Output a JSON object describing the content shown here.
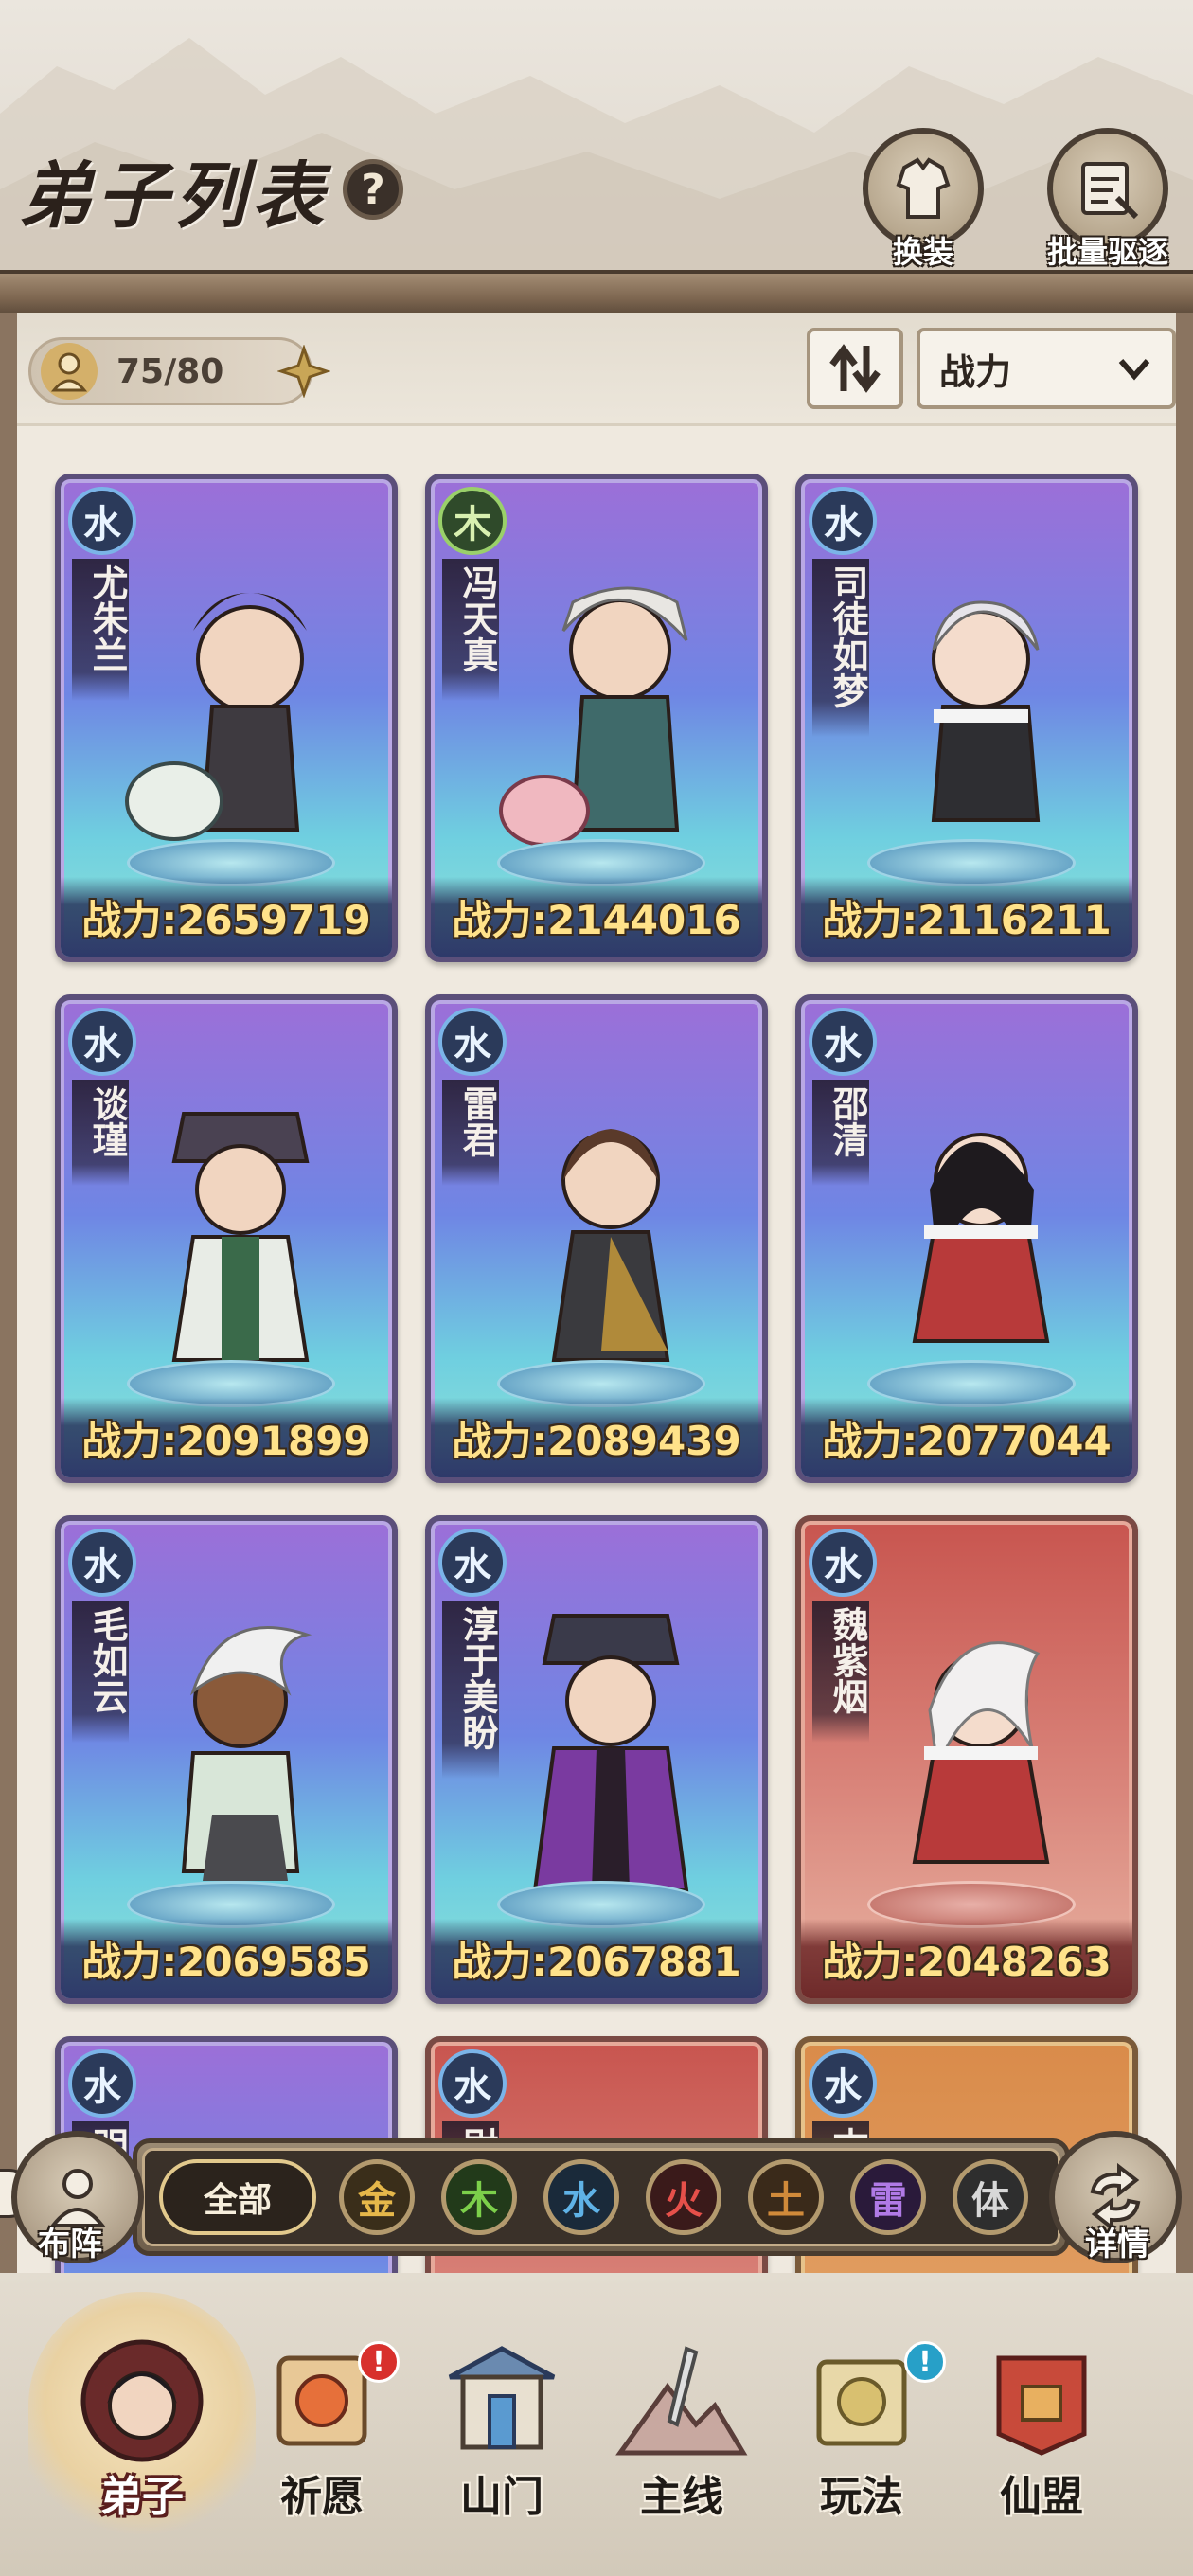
{
  "header": {
    "title": "弟子列表",
    "help_label": "?",
    "buttons": [
      {
        "label": "换装",
        "icon": "outfit-icon"
      },
      {
        "label": "批量驱逐",
        "icon": "dismiss-scroll-icon"
      }
    ]
  },
  "toolbar": {
    "capacity_text": "75/80",
    "sort_value": "战力"
  },
  "cards": [
    {
      "element": "水",
      "name": "尤朱兰",
      "power": "战力:2659719",
      "rarity": "purple"
    },
    {
      "element": "木",
      "name": "冯天真",
      "power": "战力:2144016",
      "rarity": "purple"
    },
    {
      "element": "水",
      "name": "司徒如梦",
      "power": "战力:2116211",
      "rarity": "purple"
    },
    {
      "element": "水",
      "name": "谈瑾",
      "power": "战力:2091899",
      "rarity": "purple"
    },
    {
      "element": "水",
      "name": "雷君",
      "power": "战力:2089439",
      "rarity": "purple"
    },
    {
      "element": "水",
      "name": "邵清",
      "power": "战力:2077044",
      "rarity": "purple"
    },
    {
      "element": "水",
      "name": "毛如云",
      "power": "战力:2069585",
      "rarity": "purple"
    },
    {
      "element": "水",
      "name": "淳于美盼",
      "power": "战力:2067881",
      "rarity": "purple"
    },
    {
      "element": "水",
      "name": "魏紫烟",
      "power": "战力:2048263",
      "rarity": "red"
    },
    {
      "element": "水",
      "name": "明",
      "power": "",
      "rarity": "purple"
    },
    {
      "element": "水",
      "name": "尉",
      "power": "",
      "rarity": "red"
    },
    {
      "element": "水",
      "name": "古",
      "power": "",
      "rarity": "orange"
    }
  ],
  "filter": {
    "left_label": "布阵",
    "right_label": "详情",
    "all_label": "全部",
    "elements": [
      {
        "label": "金",
        "color": "#e6b84a"
      },
      {
        "label": "木",
        "color": "#7ccf4a"
      },
      {
        "label": "水",
        "color": "#5fb2e6"
      },
      {
        "label": "火",
        "color": "#e6504a"
      },
      {
        "label": "土",
        "color": "#d08a3a"
      },
      {
        "label": "雷",
        "color": "#b07ae6"
      },
      {
        "label": "体",
        "color": "#d8d8d8"
      }
    ]
  },
  "nav": [
    {
      "label": "弟子",
      "active": true,
      "badge": ""
    },
    {
      "label": "祈愿",
      "active": false,
      "badge": "!"
    },
    {
      "label": "山门",
      "active": false,
      "badge": ""
    },
    {
      "label": "主线",
      "active": false,
      "badge": ""
    },
    {
      "label": "玩法",
      "active": false,
      "badge": "!"
    },
    {
      "label": "仙盟",
      "active": false,
      "badge": ""
    }
  ]
}
